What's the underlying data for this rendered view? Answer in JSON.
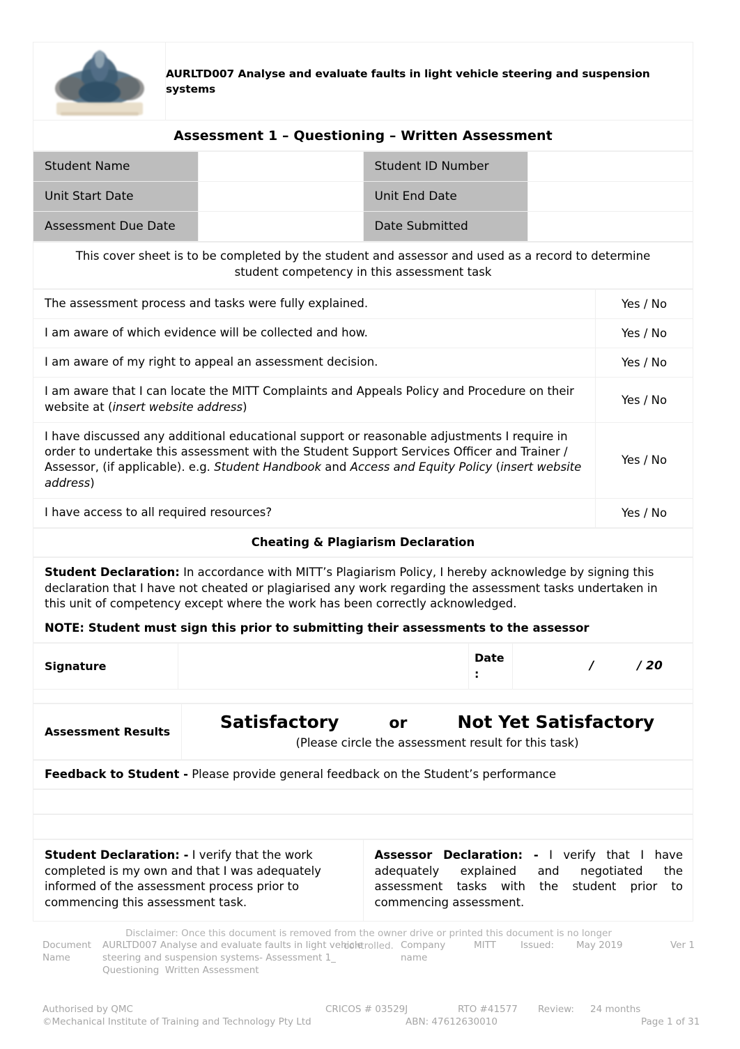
{
  "header": {
    "logo_alt": "mitt-logo",
    "unit_title": "AURLTD007 Analyse and evaluate faults in light vehicle steering and suspension systems",
    "assessment_title": "Assessment 1 – Questioning – Written Assessment"
  },
  "fields": [
    {
      "label_left": "Student Name",
      "value_left": "",
      "label_right": "Student ID Number",
      "value_right": ""
    },
    {
      "label_left": "Unit Start Date",
      "value_left": "",
      "label_right": "Unit End Date",
      "value_right": ""
    },
    {
      "label_left": "Assessment Due Date",
      "value_left": "",
      "label_right": "Date Submitted",
      "value_right": ""
    }
  ],
  "cover_note": "This cover sheet is to be completed by the student and assessor and used as a record to determine student competency in this assessment task",
  "questions": {
    "answer_label": "Yes / No",
    "items": [
      {
        "id": "q1",
        "text": "The assessment process and tasks were fully explained.",
        "answer": "Yes / No"
      },
      {
        "id": "q2",
        "text": "I am aware of which evidence will be collected and how.",
        "answer": "Yes / No"
      },
      {
        "id": "q3",
        "text": "I am aware of my right to appeal an assessment decision.",
        "answer": "Yes / No"
      },
      {
        "id": "q4",
        "text_pre": "I am aware that I can locate the MITT Complaints and Appeals Policy and Procedure on their website at (",
        "text_italic": "insert website address",
        "text_post": ")",
        "answer": "Yes / No"
      },
      {
        "id": "q5",
        "text_a": "I have discussed any additional educational support or reasonable adjustments I require in order to undertake this assessment with the Student Support Services Officer and Trainer / Assessor, (if applicable). e.g. ",
        "italic_a": "Student Handbook",
        "text_b": " and ",
        "italic_b": "Access and Equity Policy",
        "text_c": " (",
        "italic_c": "insert website address",
        "text_d": ")",
        "answer": "Yes / No"
      },
      {
        "id": "q6",
        "text": "I have access to all required resources?",
        "answer": "Yes / No"
      }
    ]
  },
  "plagiarism": {
    "heading": "Cheating & Plagiarism Declaration",
    "student_decl_bold": "Student Declaration:",
    "student_decl_text": " In accordance with MITT’s Plagiarism Policy, I hereby acknowledge by signing this declaration that I have not cheated or plagiarised any work regarding the assessment tasks undertaken in this unit of competency except where the work has been correctly acknowledged.",
    "note": "NOTE: Student must sign this prior to submitting their assessments to the assessor"
  },
  "signature": {
    "label": "Signature",
    "value": "",
    "date_label": "Date :",
    "date_slots": "/",
    "date_year": "/ 20"
  },
  "results": {
    "label": "Assessment Results",
    "option_satisfactory": "Satisfactory",
    "conjunction": "or",
    "option_not_yet": "Not Yet Satisfactory",
    "instruction": "(Please circle the assessment result for this task)"
  },
  "feedback": {
    "bold": "Feedback to Student -",
    "text": " Please provide general feedback on the Student’s performance",
    "blank_rows": 2
  },
  "declarations": {
    "student_bold": "Student Declaration: -",
    "student_text": " I verify that the work completed is my own and that I was adequately informed of the assessment process prior to commencing this assessment task.",
    "assessor_bold": "Assessor Declaration: -",
    "assessor_text": " I verify that I have adequately explained and negotiated the assessment tasks with the student prior to commencing assessment."
  },
  "footer": {
    "disclaimer": "Disclaimer: Once this document is removed from the owner drive or printed this document is no longer controlled.",
    "doc_name_label": "Document Name",
    "doc_name_value": "AURLTD007 Analyse and evaluate faults in light vehicle steering and suspension systems- Assessment 1_ Questioning  Written Assessment",
    "company_label": "Company name",
    "company_value": "MITT",
    "issued_label": "Issued:",
    "issued_value": "May 2019",
    "version": "Ver 1",
    "authorised": "Authorised by QMC",
    "cricos": "CRICOS # 03529J",
    "rto": "RTO #41577",
    "review_label": "Review:",
    "review_value": "24 months",
    "copyright": "©Mechanical Institute of Training and Technology Pty Ltd",
    "abn": "ABN: 47612630010",
    "page": "Page 1 of 31"
  },
  "colors": {
    "label_grey": "#bdbdbd",
    "border": "#efefef",
    "footer_text": "#a6a6a6",
    "logo_blue": "#4a6b80"
  }
}
